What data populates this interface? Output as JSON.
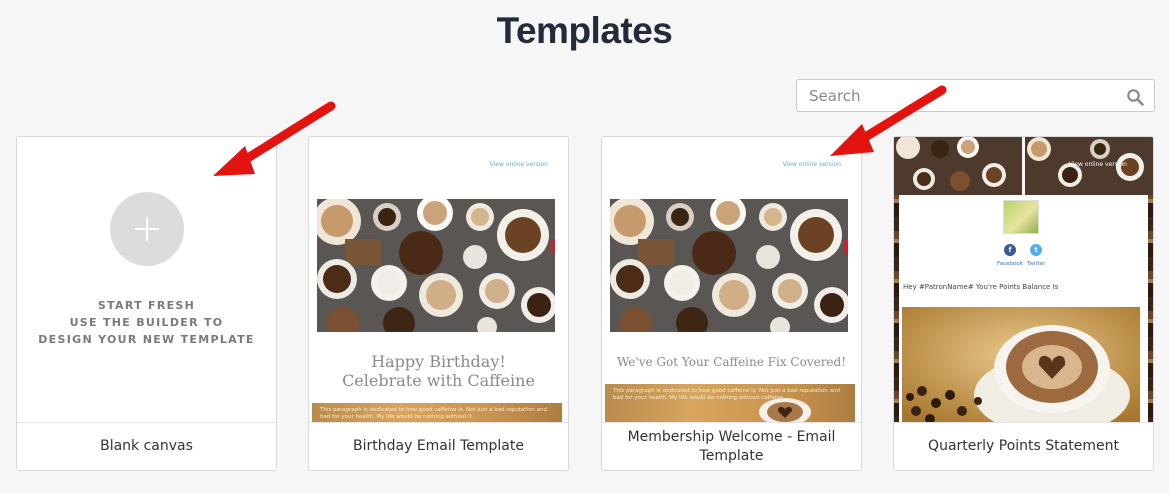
{
  "header": {
    "title": "Templates"
  },
  "search": {
    "placeholder": "Search",
    "icon": "search-icon"
  },
  "cards": [
    {
      "name": "Blank canvas",
      "start_lines": [
        "START FRESH",
        "USE THE BUILDER TO",
        "DESIGN YOUR NEW TEMPLATE"
      ],
      "icon": "plus-icon"
    },
    {
      "name": "Birthday Email Template",
      "view_online": "View online version",
      "heading_lines": [
        "Happy Birthday!",
        "Celebrate with Caffeine"
      ],
      "banner_text": "This paragraph is dedicated to how good caffeine is. Not just a bad reputation and bad for your health. My life would be nothing without it."
    },
    {
      "name": "Membership Welcome - Email Template",
      "view_online": "View online version",
      "heading": "We've Got Your Caffeine Fix Covered!",
      "banner_text": "This paragraph is dedicated to how good caffeine is. Not just a bad reputation and bad for your health. My life would be nothing without caffeine."
    },
    {
      "name": "Quarterly Points Statement",
      "view_online": "View online version",
      "social": [
        "Facebook",
        "Twitter"
      ],
      "patron_text": "Hey #PatronName# You're Points Balance Is"
    }
  ],
  "colors": {
    "accent_arrow": "#e3140f",
    "title": "#252a3a",
    "link": "#6aa9d6"
  }
}
